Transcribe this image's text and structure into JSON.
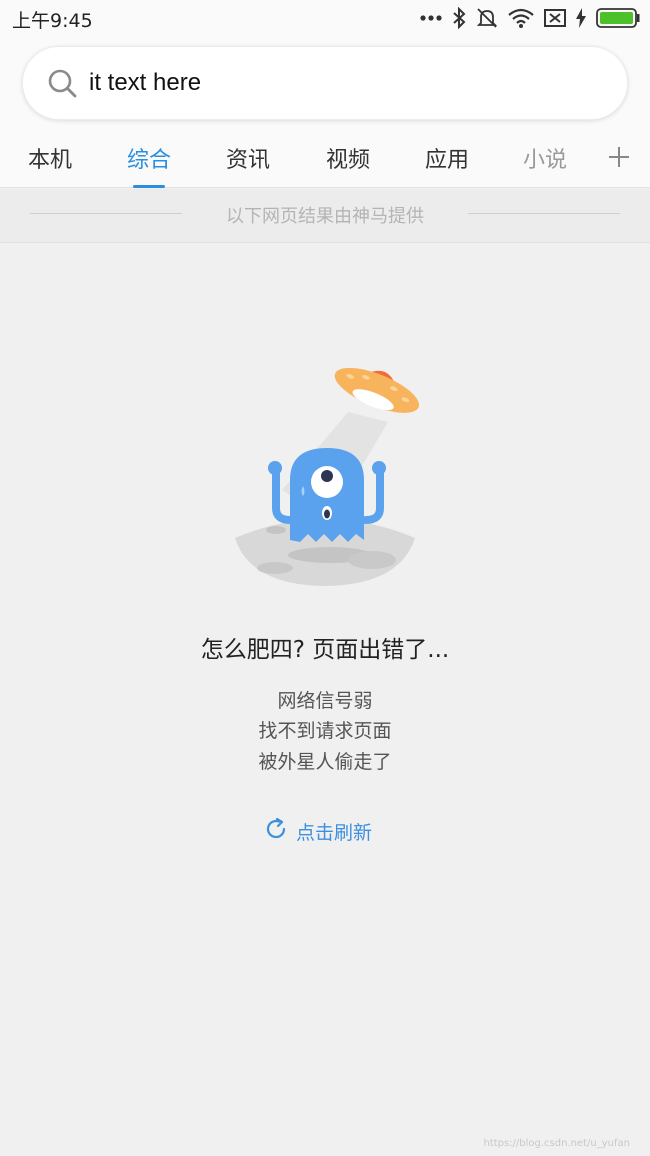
{
  "status": {
    "time": "上午9:45"
  },
  "search": {
    "value": "it text here"
  },
  "tabs": [
    {
      "label": "本机"
    },
    {
      "label": "综合"
    },
    {
      "label": "资讯"
    },
    {
      "label": "视频"
    },
    {
      "label": "应用"
    },
    {
      "label": "小说"
    }
  ],
  "active_tab": "综合",
  "provider_note": "以下网页结果由神马提供",
  "error": {
    "title": "怎么肥四? 页面出错了...",
    "lines": [
      "网络信号弱",
      "找不到请求页面",
      "被外星人偷走了"
    ]
  },
  "refresh_label": "点击刷新",
  "watermark": "https://blog.csdn.net/u_yufan",
  "colors": {
    "accent": "#2a8fe0",
    "alien": "#5aa1ee",
    "ufo": "#f7b45c",
    "battery": "#4cc12a"
  }
}
